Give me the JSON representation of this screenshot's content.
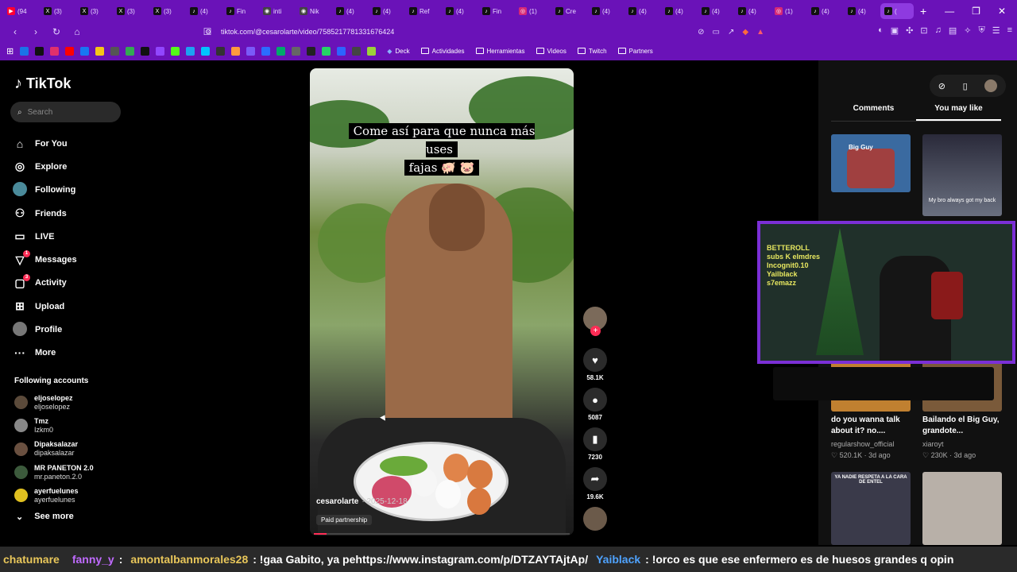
{
  "browser": {
    "tabs": [
      {
        "icon": "youtube-icon",
        "label": "(94"
      },
      {
        "icon": "x-icon",
        "label": "(3)"
      },
      {
        "icon": "x-icon",
        "label": "(3)"
      },
      {
        "icon": "x-icon",
        "label": "(3)"
      },
      {
        "icon": "x-icon",
        "label": "(3)"
      },
      {
        "icon": "tiktok-icon",
        "label": "(4)"
      },
      {
        "icon": "tiktok-icon",
        "label": "Fin"
      },
      {
        "icon": "globe-icon",
        "label": "inti"
      },
      {
        "icon": "globe-icon",
        "label": "Nik"
      },
      {
        "icon": "tiktok-icon",
        "label": "(4)"
      },
      {
        "icon": "tiktok-icon",
        "label": "(4)"
      },
      {
        "icon": "tiktok-icon",
        "label": "Ref"
      },
      {
        "icon": "tiktok-icon",
        "label": "(4)"
      },
      {
        "icon": "tiktok-icon",
        "label": "Fin"
      },
      {
        "icon": "instagram-icon",
        "label": "(1)"
      },
      {
        "icon": "tiktok-icon",
        "label": "Cre"
      },
      {
        "icon": "tiktok-icon",
        "label": "(4)"
      },
      {
        "icon": "tiktok-icon",
        "label": "(4)"
      },
      {
        "icon": "tiktok-icon",
        "label": "(4)"
      },
      {
        "icon": "tiktok-icon",
        "label": "(4)"
      },
      {
        "icon": "tiktok-icon",
        "label": "(4)"
      },
      {
        "icon": "instagram-icon",
        "label": "(1)"
      },
      {
        "icon": "tiktok-icon",
        "label": "(4)"
      },
      {
        "icon": "tiktok-icon",
        "label": "(4)"
      },
      {
        "icon": "tiktok-icon",
        "label": "("
      }
    ],
    "url": "tiktok.com/@cesarolarte/video/7585217781331676424",
    "bookmarks": [
      "Deck",
      "Actividades",
      "Herramientas",
      "Videos",
      "Twitch",
      "Partners"
    ]
  },
  "sidebar": {
    "logo": "TikTok",
    "search_placeholder": "Search",
    "nav": [
      {
        "label": "For You",
        "icon": "home-icon"
      },
      {
        "label": "Explore",
        "icon": "compass-icon"
      },
      {
        "label": "Following",
        "icon": "following-avatar-icon"
      },
      {
        "label": "Friends",
        "icon": "friends-icon"
      },
      {
        "label": "LIVE",
        "icon": "live-icon"
      },
      {
        "label": "Messages",
        "icon": "messages-icon",
        "badge": "1"
      },
      {
        "label": "Activity",
        "icon": "activity-icon",
        "badge": "3"
      },
      {
        "label": "Upload",
        "icon": "upload-icon"
      },
      {
        "label": "Profile",
        "icon": "profile-avatar-icon"
      },
      {
        "label": "More",
        "icon": "more-icon"
      }
    ],
    "following_title": "Following accounts",
    "following": [
      {
        "name": "eljoselopez",
        "handle": "eljoselopez"
      },
      {
        "name": "Tmz",
        "handle": "Izkm0"
      },
      {
        "name": "Dipaksalazar",
        "handle": "dipaksalazar"
      },
      {
        "name": "MR PANETON 2.0",
        "handle": "mr.paneton.2.0"
      },
      {
        "name": "ayerfuelunes",
        "handle": "ayerfuelunes"
      }
    ],
    "see_more": "See more"
  },
  "video": {
    "caption_line1": "Come así para que nunca más uses",
    "caption_line2": "fajas 🐖 🐷",
    "author": "cesarolarte",
    "date": "· 2025-12-18",
    "paid": "Paid partnership",
    "likes": "58.1K",
    "comments": "5087",
    "saves": "7230",
    "shares": "19.6K"
  },
  "right": {
    "tab_comments": "Comments",
    "tab_like": "You may like",
    "thumb1_text": "Big Guy",
    "thumb2_text": "My bro always got my back",
    "cards": [
      {
        "caption": "do you wanna talk about it? no....",
        "author": "regularshow_official",
        "likes": "♡ 520.1K",
        "age": "3d ago"
      },
      {
        "caption": "Bailando el Big Guy, grandote...",
        "author": "xiaroyt",
        "likes": "♡ 230K",
        "age": "3d ago"
      }
    ],
    "thumb5_text": "YA NADIE RESPETA A LA CARA DE ENTEL"
  },
  "overlay": {
    "webcam_text": "BETTEROLL subs K elmdres Incognit0.10 Yailblack s7emazz"
  },
  "chat": [
    {
      "user": "chatumare",
      "msg": "",
      "cls": "u2"
    },
    {
      "user": "fanny_y",
      "msg": ":",
      "cls": "u1"
    },
    {
      "user": "amontalbanmorales28",
      "msg": ": !gaa Gabito, ya pehttps://www.instagram.com/p/DTZAYTAjtAp/",
      "cls": "u2"
    },
    {
      "user": "Yaiblack",
      "msg": ": !orco es que ese enfermero es de huesos grandes q opin",
      "cls": "u3"
    }
  ],
  "colors": {
    "browser_chrome": "#6a12b8",
    "tiktok_red": "#fe2c55",
    "webcam_border": "#7b2fd6"
  }
}
